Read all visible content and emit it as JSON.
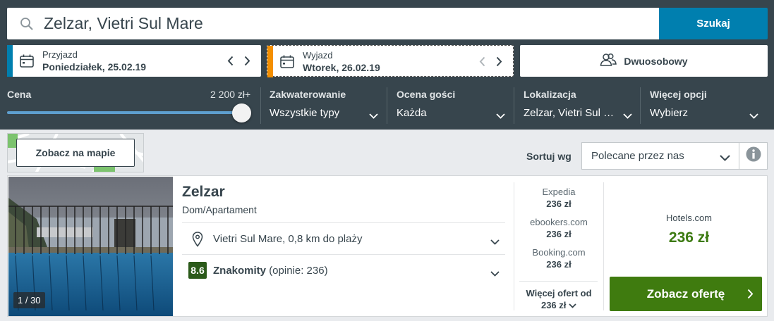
{
  "search": {
    "query": "Zelzar, Vietri Sul Mare",
    "button_label": "Szukaj",
    "icon": "search-icon"
  },
  "checkin": {
    "label": "Przyjazd",
    "value": "Poniedziałek, 25.02.19"
  },
  "checkout": {
    "label": "Wyjazd",
    "value": "Wtorek, 26.02.19"
  },
  "rooms": {
    "value": "Dwuosobowy"
  },
  "filters": {
    "price": {
      "label": "Cena",
      "value": "2 200 zł+",
      "slider_level": 1.0
    },
    "accommodation": {
      "label": "Zakwaterowanie",
      "value": "Wszystkie typy"
    },
    "rating": {
      "label": "Ocena gości",
      "value": "Każda"
    },
    "location": {
      "label": "Lokalizacja",
      "value": "Zelzar, Vietri Sul Mare"
    },
    "more": {
      "label": "Więcej opcji",
      "value": "Wybierz"
    }
  },
  "toolbar": {
    "map_label": "Zobacz na mapie",
    "sort_label": "Sortuj wg",
    "sort_value": "Polecane przez nas"
  },
  "hotel": {
    "name": "Zelzar",
    "type": "Dom/Apartament",
    "photo_count": "1 / 30",
    "location": "Vietri Sul Mare, 0,8 km do plaży",
    "rating_score": "8.6",
    "rating_label": "Znakomity",
    "rating_reviews": "(opinie: 236)",
    "offers": [
      {
        "site": "Expedia",
        "price": "236 zł"
      },
      {
        "site": "ebookers.com",
        "price": "236 zł"
      },
      {
        "site": "Booking.com",
        "price": "236 zł"
      }
    ],
    "more_offers_label": "Więcej ofert od",
    "more_offers_price": "236 zł",
    "best_site": "Hotels.com",
    "best_price": "236 zł",
    "cta_label": "Zobacz ofertę"
  },
  "colors": {
    "header_bg": "#37454d",
    "accent_blue": "#007faf",
    "checkout_stripe": "#f48f00",
    "rating_green": "#2b5a1a",
    "price_green": "#3c7a11",
    "cta_green": "#3f7b0f"
  }
}
